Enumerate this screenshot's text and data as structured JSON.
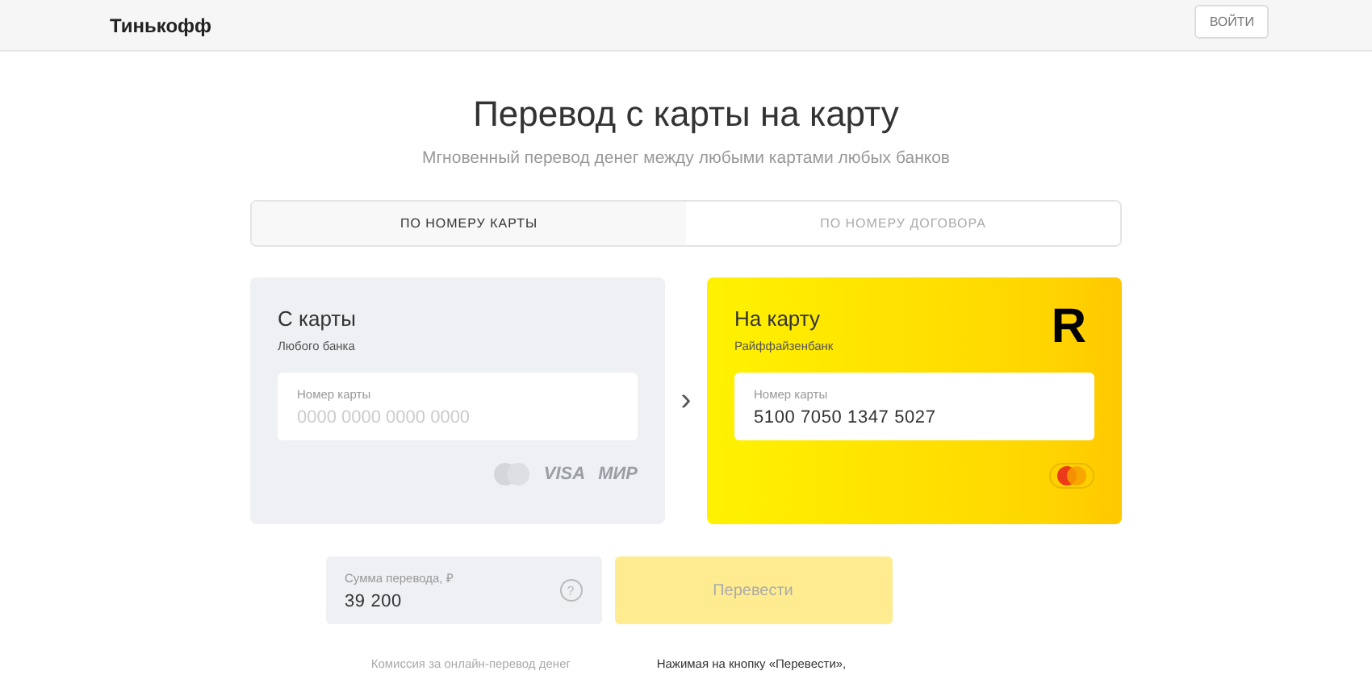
{
  "header": {
    "logo": "Тинькофф",
    "login_button": "ВОЙТИ"
  },
  "title": "Перевод с карты на карту",
  "subtitle": "Мгновенный перевод денег между любыми картами любых банков",
  "tabs": [
    {
      "label": "ПО НОМЕРУ КАРТЫ",
      "selected": true
    },
    {
      "label": "ПО НОМЕРУ ДОГОВОРА",
      "selected": false
    }
  ],
  "from_card": {
    "title": "С карты",
    "bank": "Любого банка",
    "field_label": "Номер карты",
    "placeholder": "0000 0000 0000 0000",
    "brands": [
      "VISA",
      "МИР"
    ]
  },
  "arrow": "›",
  "to_card": {
    "title": "На карту",
    "bank": "Райффайзенбанк",
    "logo_letter": "R",
    "field_label": "Номер карты",
    "value": "5100 7050 1347 5027"
  },
  "amount": {
    "label": "Сумма перевода, ₽",
    "value": "39 200",
    "help": "?"
  },
  "submit": {
    "label": "Перевести",
    "disabled": true
  },
  "notes": [
    "Комиссия за онлайн-перевод денег",
    "Нажимая на кнопку «Перевести»,"
  ]
}
